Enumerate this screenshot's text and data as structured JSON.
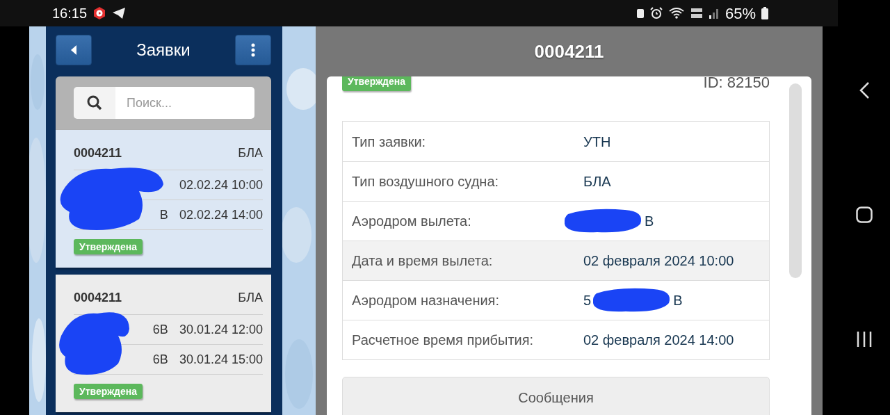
{
  "status_bar": {
    "time": "16:15",
    "battery": "65%"
  },
  "list_panel": {
    "title": "Заявки",
    "search": {
      "placeholder": "Поиск..."
    },
    "items": [
      {
        "number": "0004211",
        "aircraft": "БЛА",
        "selected": true,
        "redacted": true,
        "rows": [
          {
            "place": "",
            "time": "02.02.24 10:00"
          },
          {
            "place": "В",
            "time": "02.02.24 14:00"
          }
        ],
        "status": "Утверждена"
      },
      {
        "number": "0004211",
        "aircraft": "БЛА",
        "selected": false,
        "redacted": true,
        "rows": [
          {
            "place": "6В",
            "time": "30.01.24 12:00"
          },
          {
            "place": "6В",
            "time": "30.01.24 15:00"
          }
        ],
        "status": "Утверждена"
      }
    ]
  },
  "detail": {
    "title": "0004211",
    "status": "Утверждена",
    "id": "ID: 82150",
    "rows": [
      {
        "label": "Тип заявки:",
        "value": "УТН",
        "redacted": false,
        "shaded": false
      },
      {
        "label": "Тип воздушного судна:",
        "value": "БЛА",
        "redacted": false,
        "shaded": false
      },
      {
        "label": "Аэродром вылета:",
        "value_end": "В",
        "redacted": true,
        "shaded": false
      },
      {
        "label": "Дата и время вылета:",
        "value": "02 февраля 2024 10:00",
        "redacted": false,
        "shaded": true
      },
      {
        "label": "Аэродром назначения:",
        "value": "5",
        "value_end": "В",
        "redacted": true,
        "shaded": false
      },
      {
        "label": "Расчетное время прибытия:",
        "value": "02 февраля 2024 14:00",
        "redacted": false,
        "shaded": false
      }
    ],
    "messages_button": "Сообщения"
  }
}
